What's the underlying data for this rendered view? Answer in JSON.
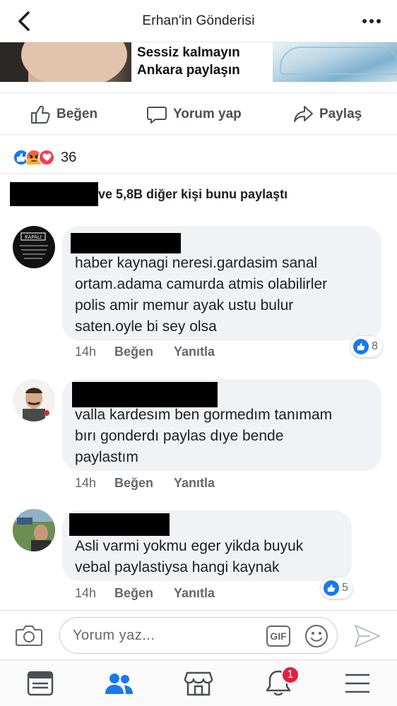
{
  "header": {
    "title": "Erhan'in Gönderisi",
    "back_icon": "chevron-left-icon",
    "more_icon": "more-dots-icon"
  },
  "post_image": {
    "line1": "Sessiz kalmayın",
    "line2": "Ankara paylaşın"
  },
  "actions": {
    "like_label": "Beğen",
    "comment_label": "Yorum yap",
    "share_label": "Paylaş"
  },
  "reactions": {
    "types": [
      "like",
      "angry",
      "love"
    ],
    "count": "36"
  },
  "shares": {
    "text": "ve 5,8B diğer kişi bunu paylaştı"
  },
  "comments": [
    {
      "lines": [
        "haber kaynagi neresi.gardasim sanal",
        "ortam.adama camurda atmis olabilirler",
        "polis amir memur ayak ustu bulur",
        "saten.oyle bi sey olsa"
      ],
      "time": "14h",
      "like_label": "Beğen",
      "reply_label": "Yanıtla",
      "likes": "8",
      "avatar_text": "KAPALI"
    },
    {
      "lines": [
        "valla kardesım ben gormedım tanımam",
        "bırı gonderdı paylas dıye bende",
        "paylastım"
      ],
      "time": "14h",
      "like_label": "Beğen",
      "reply_label": "Yanıtla"
    },
    {
      "lines": [
        "Asli varmi yokmu eger yikda buyuk",
        "vebal paylastiysa hangi kaynak"
      ],
      "time": "14h",
      "like_label": "Beğen",
      "reply_label": "Yanıtla",
      "likes": "5"
    }
  ],
  "composer": {
    "placeholder": "Yorum yaz...",
    "gif_label": "GIF"
  },
  "tabbar": {
    "items": [
      "news-feed-icon",
      "friends-icon",
      "marketplace-icon",
      "notifications-icon",
      "menu-icon"
    ],
    "notification_count": "1"
  },
  "colors": {
    "accent": "#1877f2",
    "badge_red": "#e41e3f",
    "bubble_bg": "#f0f2f5"
  }
}
